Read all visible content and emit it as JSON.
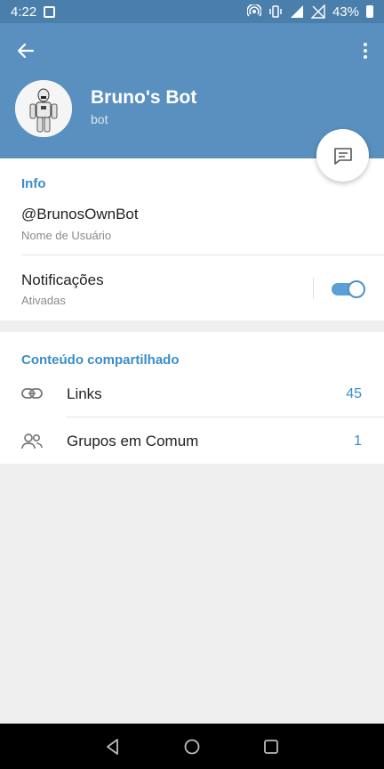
{
  "status": {
    "time": "4:22",
    "battery": "43%"
  },
  "header": {
    "title": "Bruno's Bot",
    "subtitle": "bot"
  },
  "info": {
    "section_title": "Info",
    "username": "@BrunosOwnBot",
    "username_caption": "Nome de Usuário",
    "notifications_label": "Notificações",
    "notifications_status": "Ativadas",
    "notifications_enabled": true
  },
  "shared": {
    "section_title": "Conteúdo compartilhado",
    "items": [
      {
        "label": "Links",
        "count": "45",
        "icon": "link-icon"
      },
      {
        "label": "Grupos em Comum",
        "count": "1",
        "icon": "group-icon"
      }
    ]
  },
  "colors": {
    "header": "#5a90bf",
    "status_bar": "#4a7eab",
    "accent": "#3a8dc9"
  }
}
